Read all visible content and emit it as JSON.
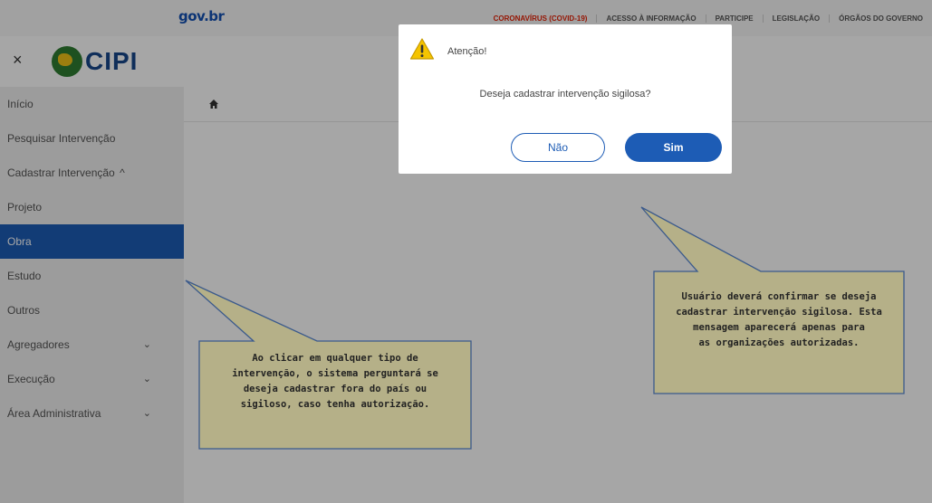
{
  "gov": {
    "logo": "gov.br",
    "links": [
      "CORONAVÍRUS (COVID-19)",
      "ACESSO À INFORMAÇÃO",
      "PARTICIPE",
      "LEGISLAÇÃO",
      "ÓRGÃOS DO GOVERNO"
    ]
  },
  "header": {
    "close_symbol": "×",
    "app_name": "CIPI"
  },
  "sidebar": {
    "items": [
      {
        "label": "Início"
      },
      {
        "label": "Pesquisar Intervenção"
      },
      {
        "label": "Cadastrar Intervenção",
        "chevron": "^"
      },
      {
        "label": "Projeto"
      },
      {
        "label": "Obra",
        "active": true
      },
      {
        "label": "Estudo"
      },
      {
        "label": "Outros"
      },
      {
        "label": "Agregadores",
        "chevron": "⌄"
      },
      {
        "label": "Execução",
        "chevron": "⌄"
      },
      {
        "label": "Área Administrativa",
        "chevron": "⌄"
      }
    ]
  },
  "modal": {
    "title": "Atenção!",
    "message": "Deseja cadastrar intervenção sigilosa?",
    "no_label": "Não",
    "yes_label": "Sim"
  },
  "callouts": {
    "left": [
      "Ao clicar em qualquer tipo de",
      "intervenção, o sistema perguntará se",
      "deseja cadastrar fora do país ou",
      "sigiloso, caso tenha autorização."
    ],
    "right": [
      "Usuário deverá confirmar se deseja",
      "cadastrar intervenção sigilosa. Esta",
      "mensagem aparecerá apenas para",
      "as organizações autorizadas."
    ]
  },
  "colors": {
    "primary": "#1d5cb5",
    "callout_fill": "#b5b088",
    "callout_border": "#3b5a8c",
    "warning": "#f5c400"
  }
}
